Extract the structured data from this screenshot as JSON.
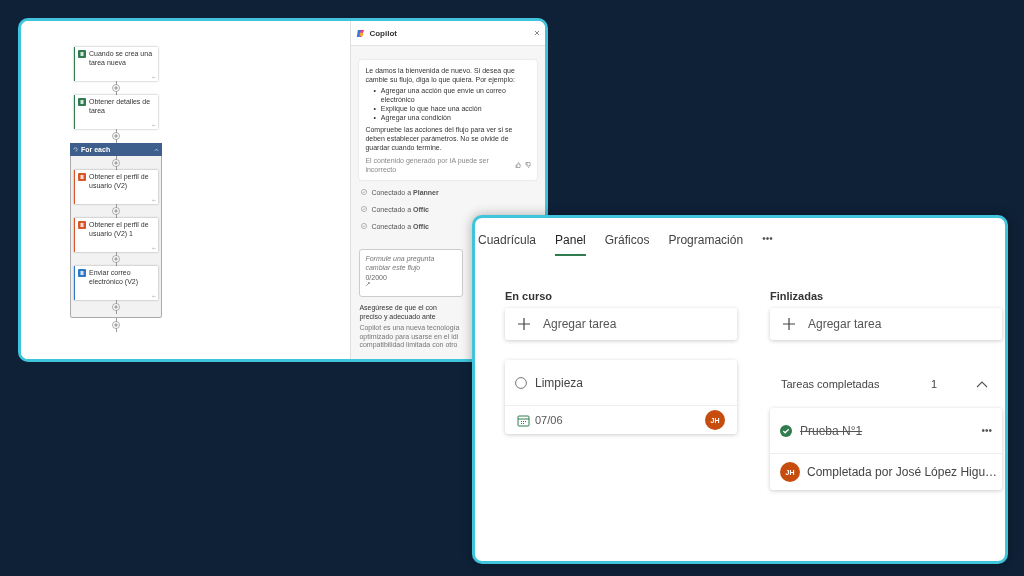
{
  "flow": {
    "steps": [
      {
        "kind": "planner",
        "title": "Cuando se crea una tarea nueva"
      },
      {
        "kind": "planner",
        "title": "Obtener detalles de tarea"
      },
      {
        "kind": "foreach",
        "title": "For each",
        "expanded": true,
        "children": [
          {
            "kind": "office",
            "title": "Obtener el perfil de usuario (V2)"
          },
          {
            "kind": "office",
            "title": "Obtener el perfil de usuario (V2) 1"
          },
          {
            "kind": "outlook",
            "title": "Enviar correo electrónico (V2)"
          }
        ]
      }
    ]
  },
  "copilot": {
    "title": "Copilot",
    "message": {
      "intro": "Le damos la bienvenida de nuevo. Si desea que cambie su flujo, diga lo que quiera. Por ejemplo:",
      "bullet": "•",
      "bullets": [
        "Agregar una acción que envíe un correo electrónico",
        "Explique lo que hace una acción",
        "Agregar una condición"
      ],
      "outro": "Compruebe las acciones del flujo para ver si se deben establecer parámetros. No se olvide de guardar cuando termine.",
      "disclaimer": "El contenido generado por IA puede ser incorrecto"
    },
    "connections": [
      "Conectado a **Planner**",
      "Conectado a **Offic**",
      "Conectado a **Offic**"
    ],
    "input": {
      "placeholder": "Formule una pregunta\ncambiar este flujo",
      "counter": "0/2000"
    },
    "notice": [
      "Asegúrese de que el con",
      "preciso y adecuado ante"
    ],
    "fine_print": [
      "Copilot es una nueva tecnología",
      "optimizado para usarse en el idi",
      "compatibilidad limitada con otro"
    ]
  },
  "planner": {
    "tabs": [
      {
        "label": "Cuadrícula",
        "selected": false
      },
      {
        "label": "Panel",
        "selected": true
      },
      {
        "label": "Gráficos",
        "selected": false
      },
      {
        "label": "Programación",
        "selected": false
      }
    ],
    "more": "•••",
    "columns": [
      {
        "title": "En curso",
        "add": "Agregar tarea",
        "tasks": [
          {
            "title": "Limpieza",
            "completed": false,
            "due": "07/06",
            "assignee": "JH"
          }
        ]
      },
      {
        "title": "Finlizadas",
        "add": "Agregar tarea",
        "completed_section": {
          "label": "Tareas completadas",
          "count": "1",
          "expanded": true,
          "tasks": [
            {
              "title": "Prueba N°1",
              "completed": true,
              "completed_by": "Completada por José López Higu…",
              "assignee": "JH"
            }
          ]
        }
      }
    ]
  }
}
